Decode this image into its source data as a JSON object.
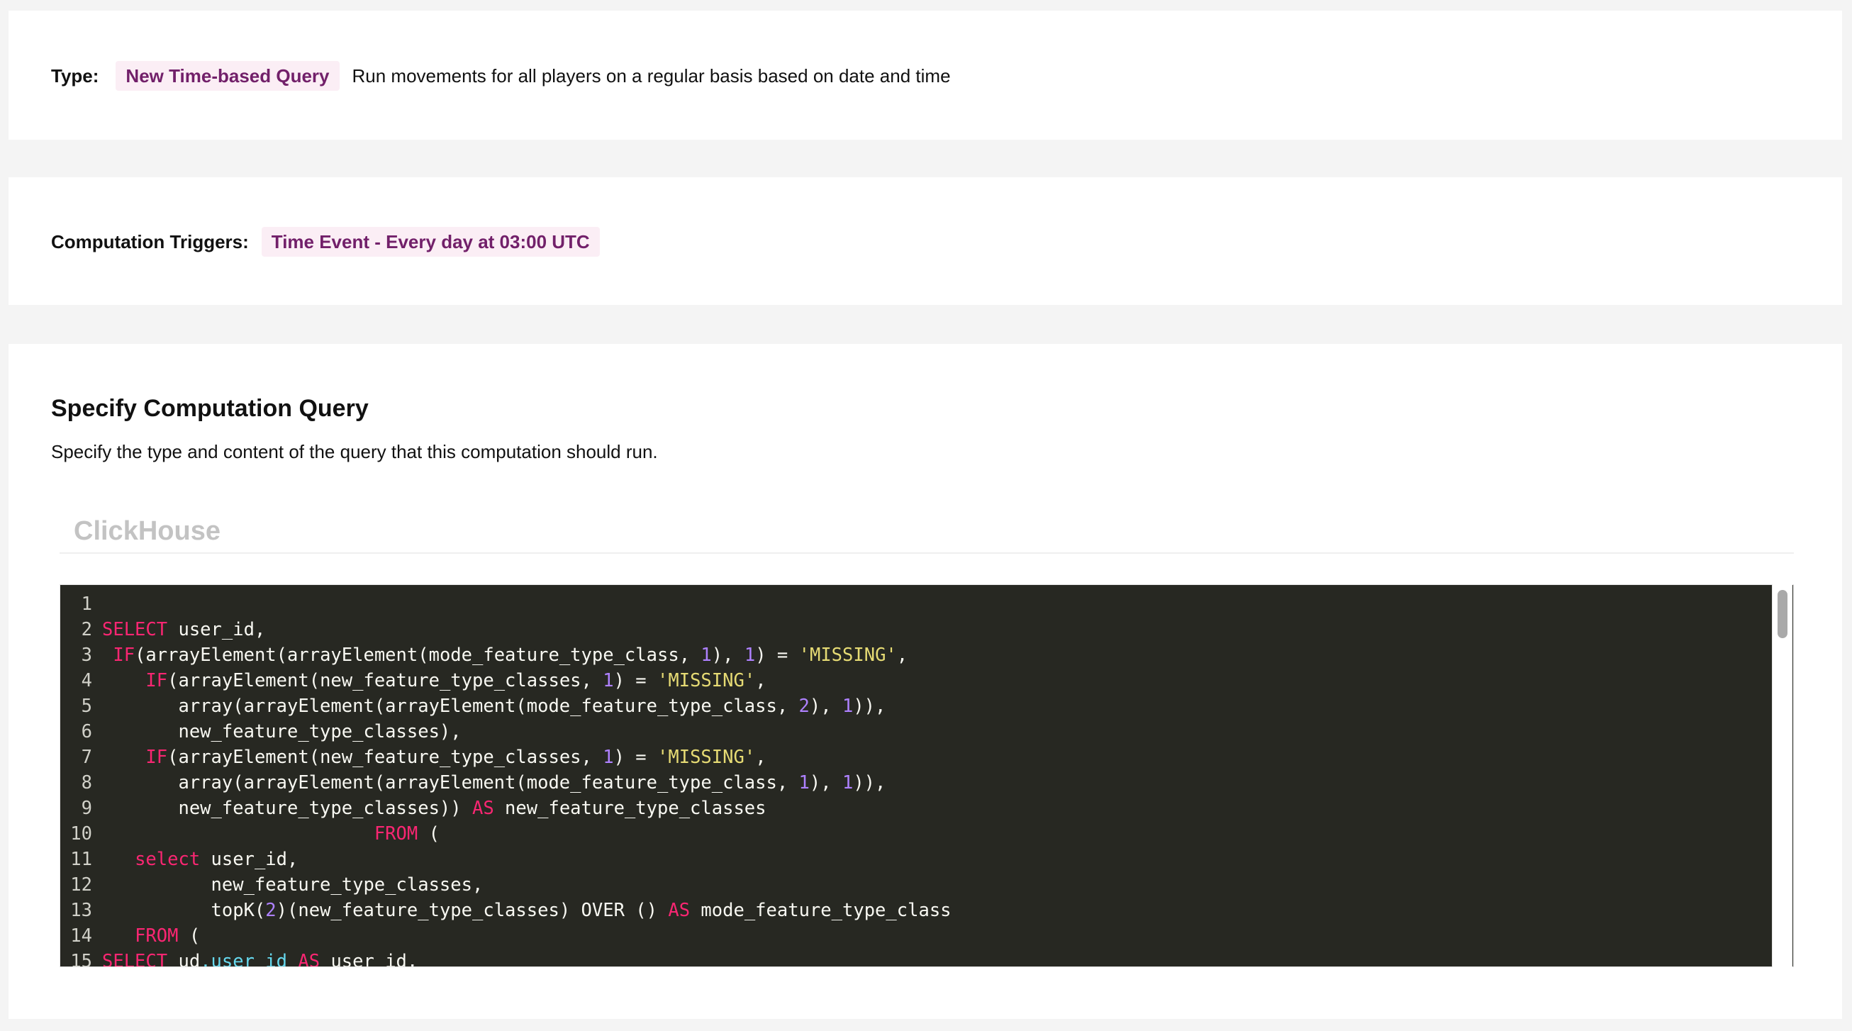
{
  "type_card": {
    "label": "Type:",
    "chip": "New Time-based Query",
    "description": "Run movements for all players on a regular basis based on date and time"
  },
  "triggers_card": {
    "label": "Computation Triggers:",
    "chip": "Time Event - Every day at 03:00 UTC"
  },
  "query_card": {
    "title": "Specify Computation Query",
    "description": "Specify the type and content of the query that this computation should run.",
    "language_tab": "ClickHouse"
  },
  "colors": {
    "chip_bg": "#fbeef5",
    "chip_text": "#72206a",
    "editor_bg": "#272822",
    "keyword": "#f92672",
    "number": "#ae81ff",
    "string": "#e6db74"
  },
  "code_lines": [
    {
      "n": "1",
      "tokens": [
        {
          "t": "",
          "c": "txt"
        }
      ]
    },
    {
      "n": "2",
      "tokens": [
        {
          "t": "SELECT",
          "c": "kw"
        },
        {
          "t": " user_id,",
          "c": "txt"
        }
      ]
    },
    {
      "n": "3",
      "tokens": [
        {
          "t": " ",
          "c": "txt"
        },
        {
          "t": "IF",
          "c": "kw"
        },
        {
          "t": "(arrayElement(arrayElement(mode_feature_type_class, ",
          "c": "txt"
        },
        {
          "t": "1",
          "c": "num"
        },
        {
          "t": "), ",
          "c": "txt"
        },
        {
          "t": "1",
          "c": "num"
        },
        {
          "t": ") = ",
          "c": "txt"
        },
        {
          "t": "'MISSING'",
          "c": "str"
        },
        {
          "t": ",",
          "c": "txt"
        }
      ]
    },
    {
      "n": "4",
      "tokens": [
        {
          "t": "    ",
          "c": "txt"
        },
        {
          "t": "IF",
          "c": "kw"
        },
        {
          "t": "(arrayElement(new_feature_type_classes, ",
          "c": "txt"
        },
        {
          "t": "1",
          "c": "num"
        },
        {
          "t": ") = ",
          "c": "txt"
        },
        {
          "t": "'MISSING'",
          "c": "str"
        },
        {
          "t": ",",
          "c": "txt"
        }
      ]
    },
    {
      "n": "5",
      "tokens": [
        {
          "t": "       array(arrayElement(arrayElement(mode_feature_type_class, ",
          "c": "txt"
        },
        {
          "t": "2",
          "c": "num"
        },
        {
          "t": "), ",
          "c": "txt"
        },
        {
          "t": "1",
          "c": "num"
        },
        {
          "t": ")),",
          "c": "txt"
        }
      ]
    },
    {
      "n": "6",
      "tokens": [
        {
          "t": "       new_feature_type_classes),",
          "c": "txt"
        }
      ]
    },
    {
      "n": "7",
      "tokens": [
        {
          "t": "    ",
          "c": "txt"
        },
        {
          "t": "IF",
          "c": "kw"
        },
        {
          "t": "(arrayElement(new_feature_type_classes, ",
          "c": "txt"
        },
        {
          "t": "1",
          "c": "num"
        },
        {
          "t": ") = ",
          "c": "txt"
        },
        {
          "t": "'MISSING'",
          "c": "str"
        },
        {
          "t": ",",
          "c": "txt"
        }
      ]
    },
    {
      "n": "8",
      "tokens": [
        {
          "t": "       array(arrayElement(arrayElement(mode_feature_type_class, ",
          "c": "txt"
        },
        {
          "t": "1",
          "c": "num"
        },
        {
          "t": "), ",
          "c": "txt"
        },
        {
          "t": "1",
          "c": "num"
        },
        {
          "t": ")),",
          "c": "txt"
        }
      ]
    },
    {
      "n": "9",
      "tokens": [
        {
          "t": "       new_feature_type_classes)) ",
          "c": "txt"
        },
        {
          "t": "AS",
          "c": "kw"
        },
        {
          "t": " new_feature_type_classes",
          "c": "txt"
        }
      ]
    },
    {
      "n": "10",
      "tokens": [
        {
          "t": "                         ",
          "c": "txt"
        },
        {
          "t": "FROM",
          "c": "kw"
        },
        {
          "t": " (",
          "c": "txt"
        }
      ]
    },
    {
      "n": "11",
      "tokens": [
        {
          "t": "   ",
          "c": "txt"
        },
        {
          "t": "select",
          "c": "kw"
        },
        {
          "t": " user_id,",
          "c": "txt"
        }
      ]
    },
    {
      "n": "12",
      "tokens": [
        {
          "t": "          new_feature_type_classes,",
          "c": "txt"
        }
      ]
    },
    {
      "n": "13",
      "tokens": [
        {
          "t": "          topK(",
          "c": "txt"
        },
        {
          "t": "2",
          "c": "num"
        },
        {
          "t": ")(new_feature_type_classes) OVER () ",
          "c": "txt"
        },
        {
          "t": "AS",
          "c": "kw"
        },
        {
          "t": " mode_feature_type_class",
          "c": "txt"
        }
      ]
    },
    {
      "n": "14",
      "tokens": [
        {
          "t": "   ",
          "c": "txt"
        },
        {
          "t": "FROM",
          "c": "kw"
        },
        {
          "t": " (",
          "c": "txt"
        }
      ]
    },
    {
      "n": "15",
      "tokens": [
        {
          "t": "SELECT",
          "c": "kw"
        },
        {
          "t": " ud",
          "c": "txt"
        },
        {
          "t": ".user_id",
          "c": "fld"
        },
        {
          "t": " ",
          "c": "txt"
        },
        {
          "t": "AS",
          "c": "kw"
        },
        {
          "t": " user_id,",
          "c": "txt"
        }
      ]
    }
  ]
}
